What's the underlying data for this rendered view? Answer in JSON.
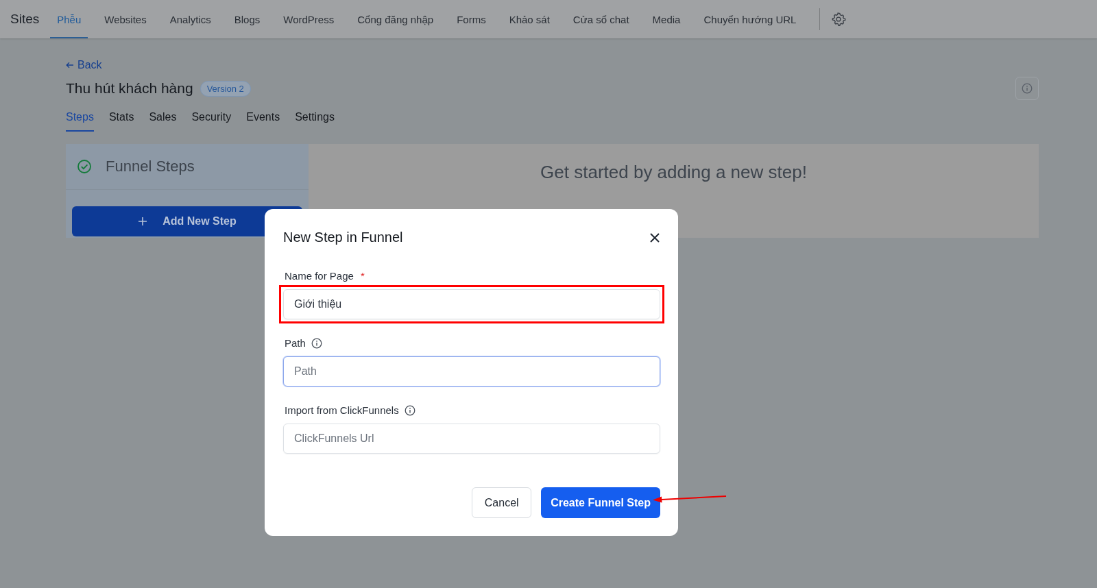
{
  "nav": {
    "brand": "Sites",
    "items": [
      {
        "label": "Phễu",
        "selected": true
      },
      {
        "label": "Websites",
        "selected": false
      },
      {
        "label": "Analytics",
        "selected": false
      },
      {
        "label": "Blogs",
        "selected": false
      },
      {
        "label": "WordPress",
        "selected": false
      },
      {
        "label": "Cổng đăng nhập",
        "selected": false
      },
      {
        "label": "Forms",
        "selected": false
      },
      {
        "label": "Khảo sát",
        "selected": false
      },
      {
        "label": "Cửa sổ chat",
        "selected": false
      },
      {
        "label": "Media",
        "selected": false
      },
      {
        "label": "Chuyển hướng URL",
        "selected": false
      }
    ]
  },
  "back": "Back",
  "title": "Thu hút khách hàng",
  "version_badge": "Version 2",
  "tabs": [
    {
      "label": "Steps",
      "selected": true
    },
    {
      "label": "Stats",
      "selected": false
    },
    {
      "label": "Sales",
      "selected": false
    },
    {
      "label": "Security",
      "selected": false
    },
    {
      "label": "Events",
      "selected": false
    },
    {
      "label": "Settings",
      "selected": false
    }
  ],
  "steps_panel": {
    "title": "Funnel Steps",
    "add_button": "Add New Step"
  },
  "empty_state": "Get started by adding a new step!",
  "modal": {
    "title": "New Step in Funnel",
    "fields": [
      {
        "label": "Name for Page",
        "required_mark": "*",
        "info": false,
        "value": "Giới thiệu",
        "highlighted": true,
        "focused": false
      },
      {
        "label": "Path",
        "info": true,
        "placeholder": "Path",
        "highlighted": false,
        "focused": true
      },
      {
        "label": "Import from ClickFunnels",
        "info": true,
        "placeholder": "ClickFunnels Url",
        "highlighted": false,
        "focused": false
      }
    ],
    "buttons": [
      {
        "label": "Cancel",
        "kind": "secondary",
        "pointed": false
      },
      {
        "label": "Create Funnel Step",
        "kind": "primary",
        "pointed": true
      }
    ]
  }
}
